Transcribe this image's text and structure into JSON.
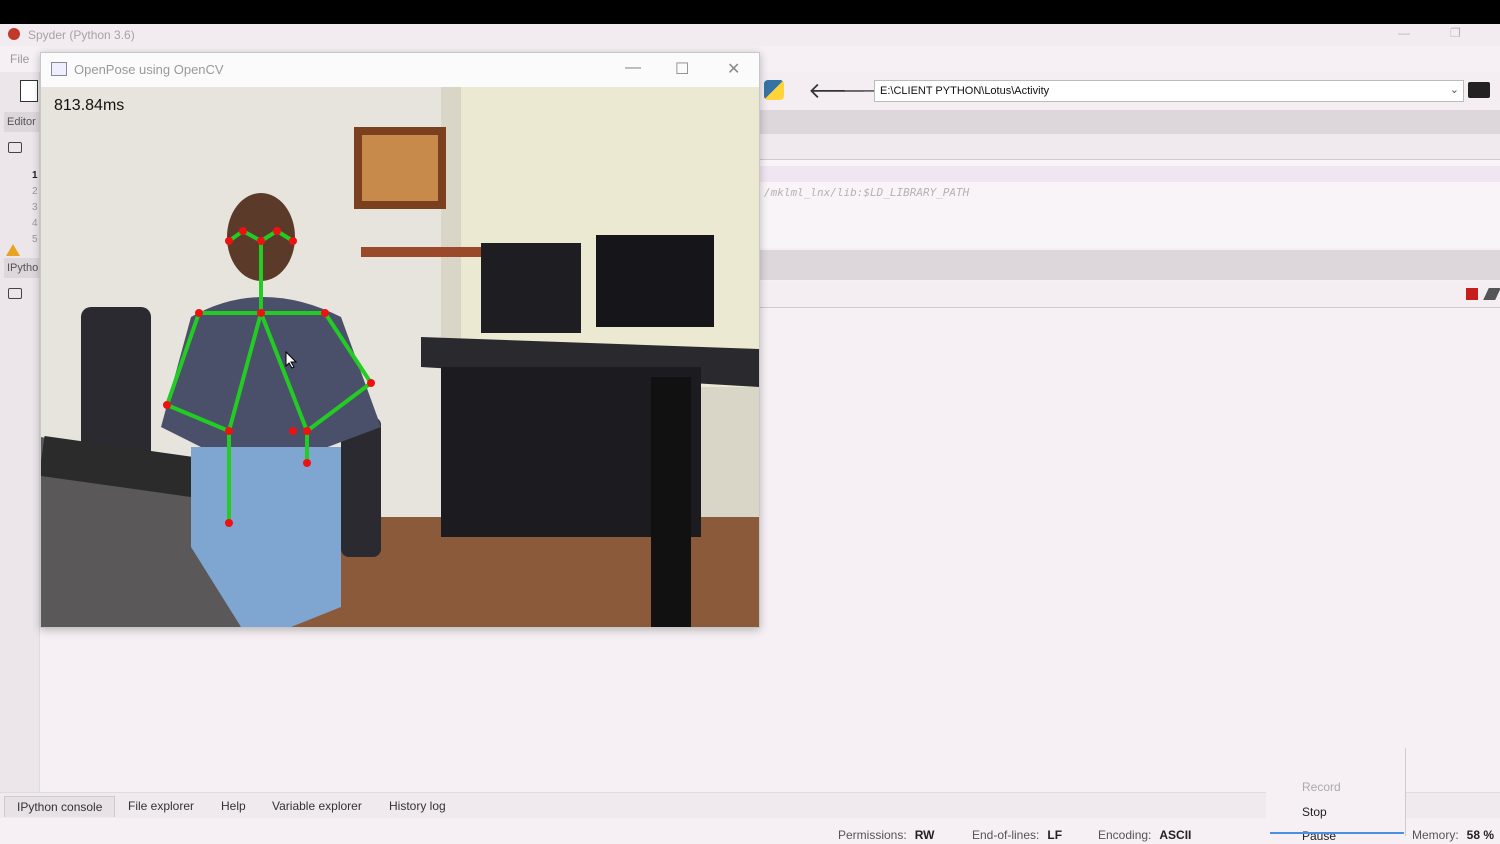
{
  "spyder": {
    "title": "Spyder (Python 3.6)",
    "menu_first": "File",
    "left_tabs": {
      "editor": "Editor",
      "ipython": "IPytho"
    },
    "line_numbers": [
      "1",
      "2",
      "3",
      "4",
      "5"
    ],
    "path": "E:\\CLIENT PYTHON\\Lotus\\Activity",
    "code_line": "/mklml_lnx/lib:$LD_LIBRARY_PATH"
  },
  "opencv_window": {
    "title": "OpenPose using OpenCV",
    "fps_text": "813.84ms"
  },
  "bottom_tabs": [
    "IPython console",
    "File explorer",
    "Help",
    "Variable explorer",
    "History log"
  ],
  "status": {
    "permissions_label": "Permissions:",
    "permissions_value": "RW",
    "eol_label": "End-of-lines:",
    "eol_value": "LF",
    "encoding_label": "Encoding:",
    "encoding_value": "ASCII",
    "memory_label": "Memory:",
    "memory_value": "58 %"
  },
  "record_menu": {
    "record": "Record",
    "stop": "Stop",
    "pause": "Pause"
  },
  "icons": [
    "spyder-logo-icon",
    "new-file-icon",
    "python-logo-icon",
    "back-arrow-icon",
    "forward-arrow-icon",
    "open-folder-icon",
    "stop-icon",
    "eraser-icon",
    "warning-icon"
  ],
  "colors": {
    "skeleton_line": "#22cc22",
    "skeleton_joint": "#ee1111",
    "stop_button": "#c81d1d"
  }
}
